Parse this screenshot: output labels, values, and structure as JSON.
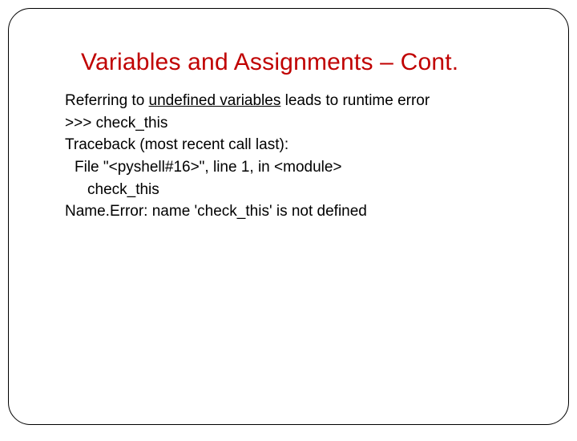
{
  "title": "Variables and Assignments – Cont.",
  "intro_pre": "Referring to ",
  "intro_underlined": "undefined variables",
  "intro_post": " leads to runtime error",
  "lines": {
    "prompt": ">>> check_this",
    "traceback": "Traceback (most recent call last):",
    "file": "File \"<pyshell#16>\", line 1, in <module>",
    "ref": "check_this",
    "error": "Name.Error: name 'check_this' is not defined"
  }
}
